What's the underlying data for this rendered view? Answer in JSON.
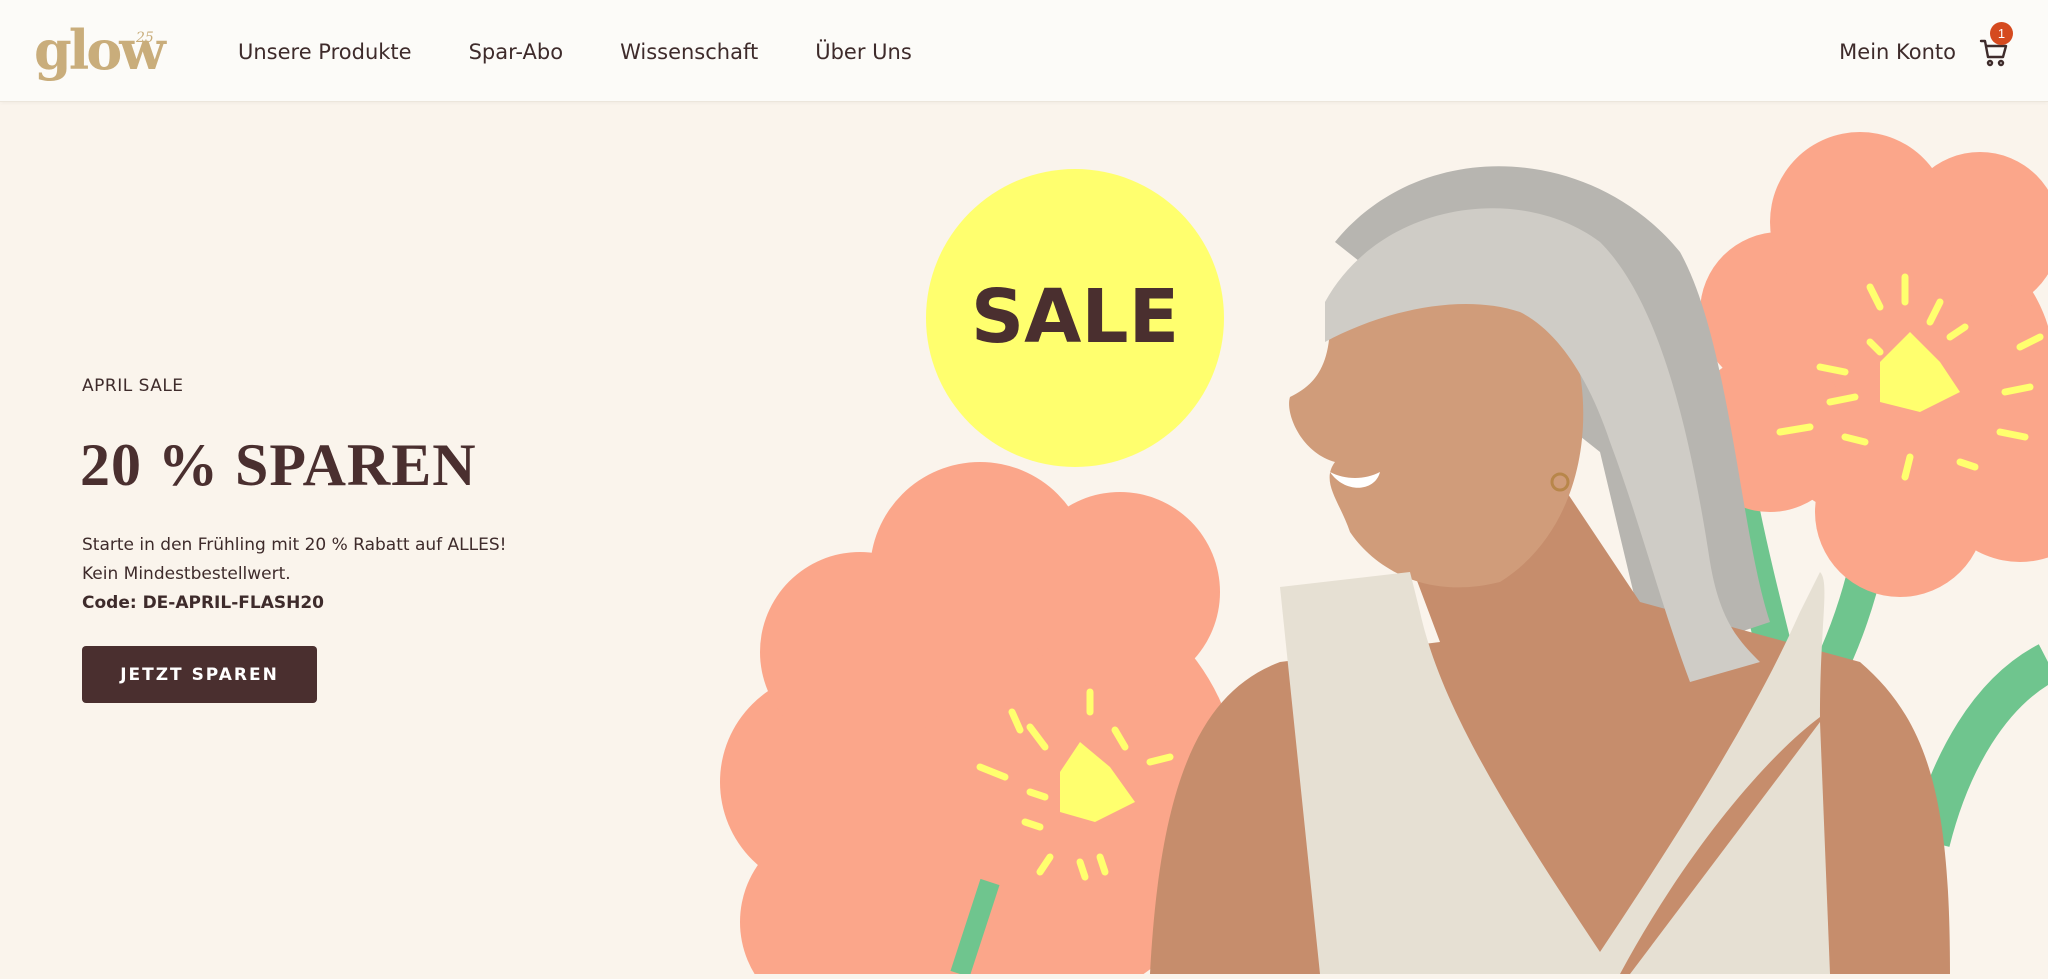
{
  "brand": {
    "logo_text": "glow",
    "logo_sup": "25",
    "color": "#c9ad7b"
  },
  "nav": {
    "items": [
      "Unsere Produkte",
      "Spar-Abo",
      "Wissenschaft",
      "Über Uns"
    ],
    "account": "Mein Konto",
    "cart_count": "1",
    "cart_icon": "cart-icon"
  },
  "hero": {
    "eyebrow": "APRIL SALE",
    "headline": "20 % SPAREN",
    "line1": "Starte in den Frühling mit 20 % Rabatt auf ALLES!",
    "line2": "Kein Mindestbestellwert.",
    "code": "Code: DE-APRIL-FLASH20",
    "cta": "JETZT SPAREN",
    "sale_badge": "SALE"
  },
  "colors": {
    "background": "#faf4ec",
    "primary": "#4a2f2f",
    "badge": "#ffff6e",
    "flower": "#fba68a",
    "stem": "#6fc58e",
    "cart_badge": "#d54a1f"
  }
}
